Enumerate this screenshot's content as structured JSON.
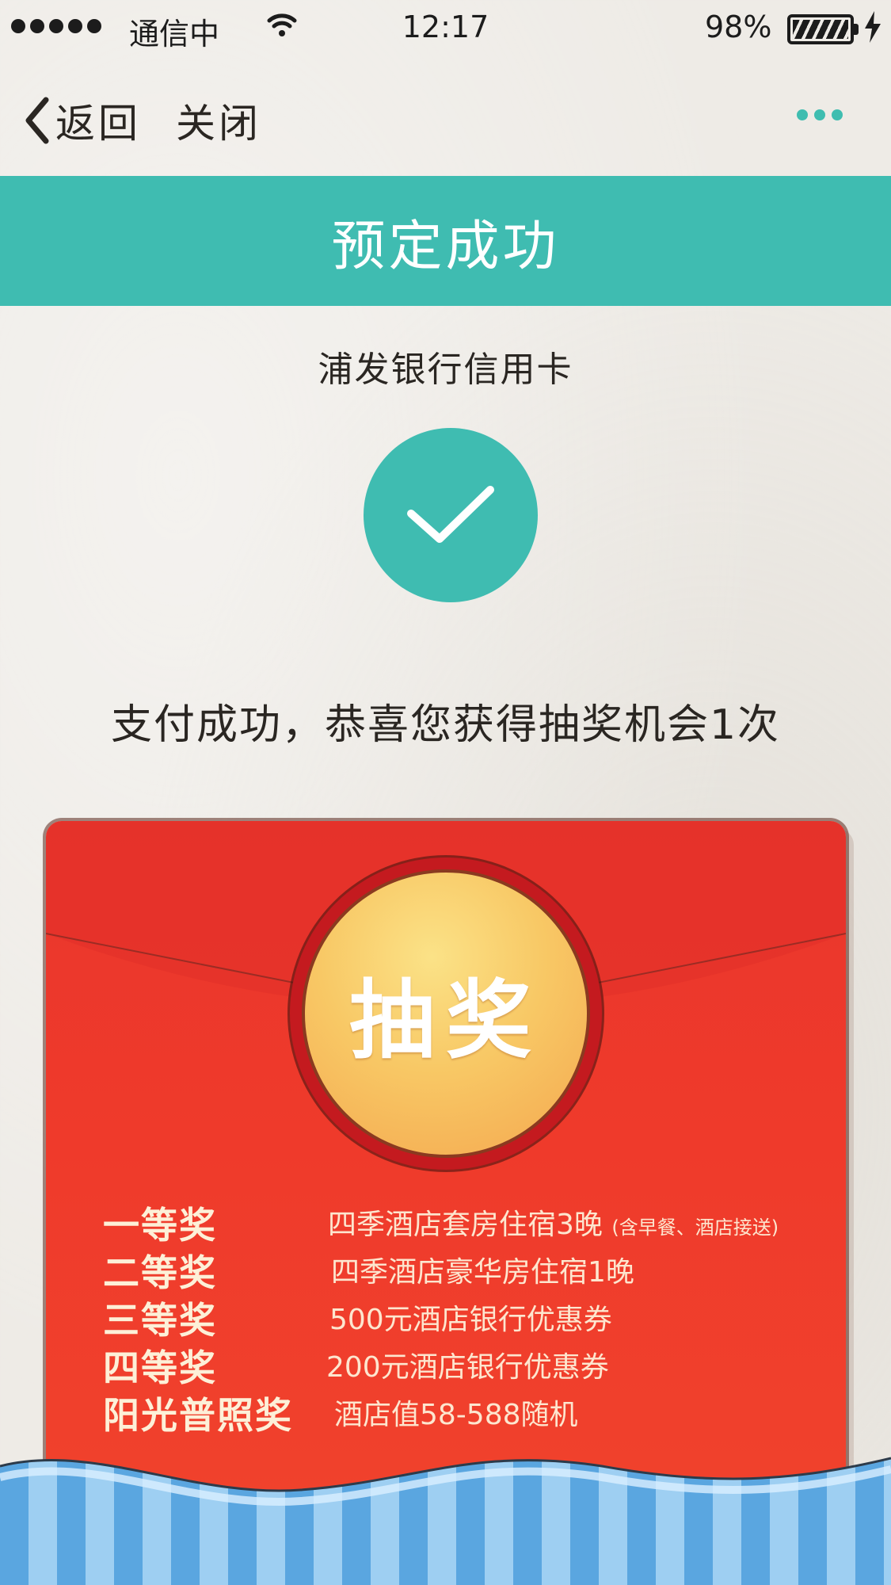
{
  "status_bar": {
    "carrier": "通信中",
    "time": "12:17",
    "battery": "98%"
  },
  "nav": {
    "back_label": "返回",
    "close_label": "关闭"
  },
  "banner": {
    "title": "预定成功"
  },
  "bank_name": "浦发银行信用卡",
  "success_message": "支付成功，恭喜您获得抽奖机会1次",
  "draw_button": {
    "label": "抽奖"
  },
  "prizes": [
    {
      "rank": "一等奖",
      "description": "四季酒店套房住宿3晚",
      "note": "(含早餐、酒店接送)"
    },
    {
      "rank": "二等奖",
      "description": "四季酒店豪华房住宿1晚",
      "note": ""
    },
    {
      "rank": "三等奖",
      "description": "500元酒店银行优惠券",
      "note": ""
    },
    {
      "rank": "四等奖",
      "description": "200元酒店银行优惠券",
      "note": ""
    },
    {
      "rank": "阳光普照奖",
      "description": "酒店值58-588随机",
      "note": ""
    }
  ],
  "colors": {
    "teal": "#3fbcb1",
    "envelope_red": "#ef3a2b",
    "gold": "#f8c865",
    "wave_blue": "#5aa6e0"
  }
}
